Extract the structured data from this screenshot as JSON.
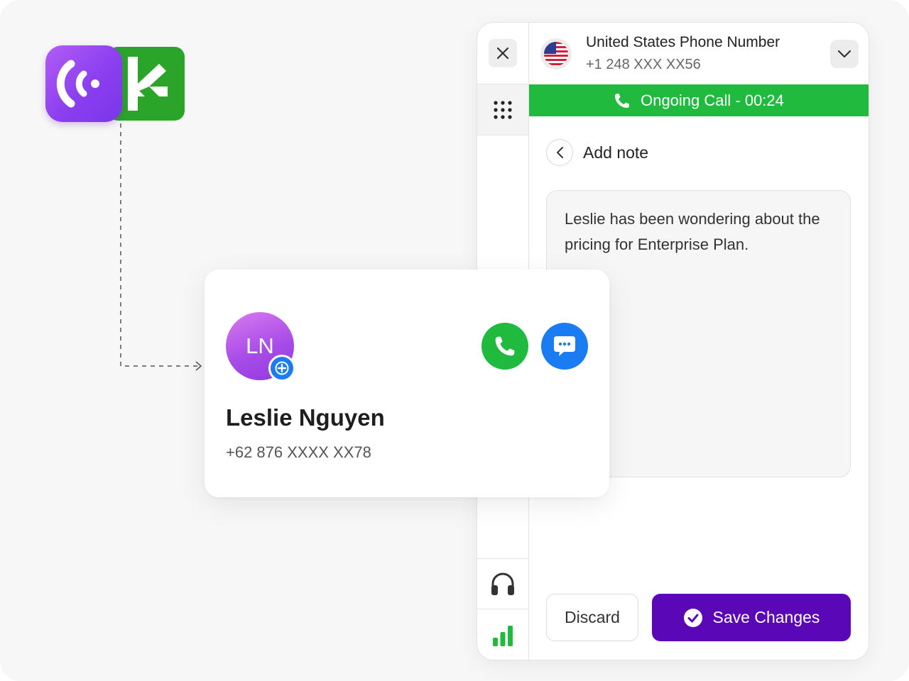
{
  "header": {
    "title": "United States Phone Number",
    "number": "+1 248 XXX XX56"
  },
  "call_status": {
    "label": "Ongoing Call - 00:24",
    "color": "#1fba3e"
  },
  "note": {
    "title": "Add note",
    "text": "Leslie has been wondering about the pricing for Enterprise Plan."
  },
  "actions": {
    "discard_label": "Discard",
    "save_label": "Save Changes",
    "save_color": "#5a07b8"
  },
  "contact": {
    "initials": "LN",
    "name": "Leslie Nguyen",
    "phone": "+62 876 XXXX XX78"
  },
  "icons": {
    "rail": [
      "close-icon",
      "keypad-icon",
      "headset-icon",
      "signal-bars-icon"
    ],
    "logos": [
      "broadcast-logo",
      "k-arrow-logo"
    ]
  },
  "colors": {
    "brand_purple": "#8a3ff0",
    "brand_green": "#2aa52a",
    "accent_blue": "#1a7cf2"
  }
}
